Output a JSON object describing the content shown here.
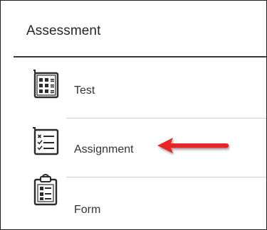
{
  "panel": {
    "title": "Assessment"
  },
  "items": [
    {
      "label": "Test",
      "icon": "test-grid-icon"
    },
    {
      "label": "Assignment",
      "icon": "checklist-icon"
    },
    {
      "label": "Form",
      "icon": "clipboard-form-icon"
    }
  ],
  "annotation": {
    "arrow_color": "#e8252a",
    "icon": "red-arrow-icon"
  },
  "colors": {
    "text": "#333333",
    "rule_strong": "#3a3a3a",
    "rule_light": "#cfcfcf",
    "icon": "#2b2b2b"
  }
}
